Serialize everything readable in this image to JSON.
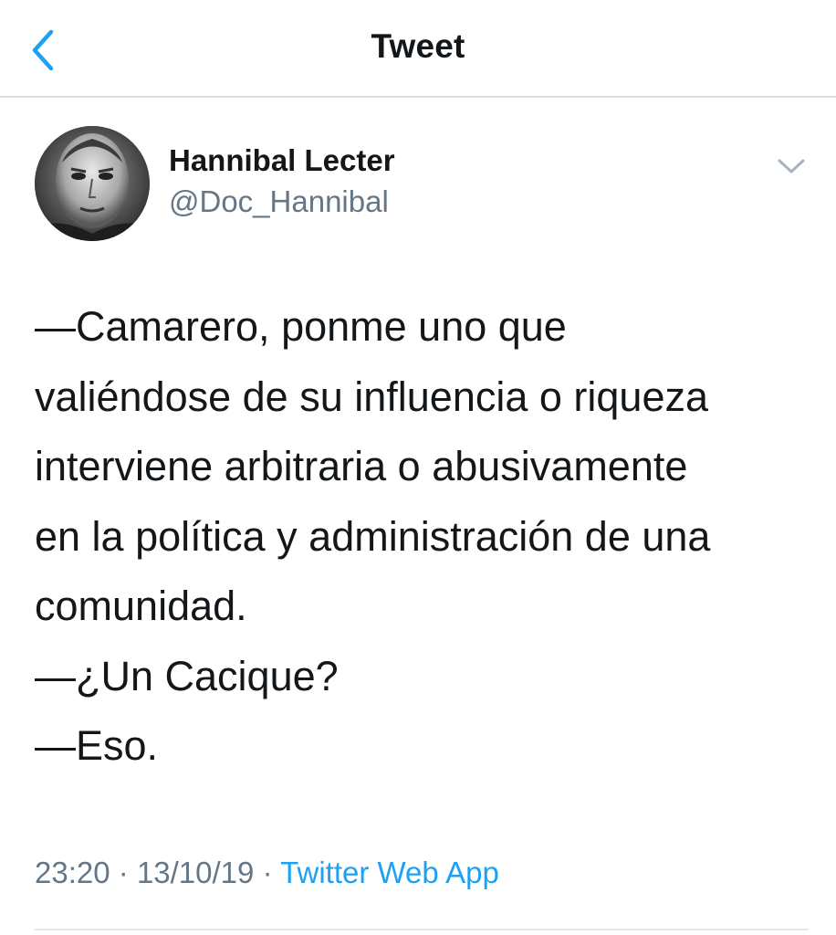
{
  "header": {
    "title": "Tweet",
    "back_icon": "chevron-left-icon"
  },
  "tweet": {
    "author": {
      "name": "Hannibal Lecter",
      "handle": "@Doc_Hannibal"
    },
    "menu_icon": "chevron-down-icon",
    "body_lines": [
      "—Camarero, ponme uno que",
      "valiéndose de su influencia o riqueza",
      "interviene arbitraria o abusivamente",
      "en la política y administración de una",
      "comunidad.",
      "—¿Un Cacique?",
      "—Eso."
    ],
    "time": "23:20",
    "date": "13/10/19",
    "separator": "·",
    "source": "Twitter Web App"
  },
  "colors": {
    "accent": "#1da1f2",
    "text": "#14171a",
    "secondary": "#657786",
    "divider": "#d6dde3"
  }
}
